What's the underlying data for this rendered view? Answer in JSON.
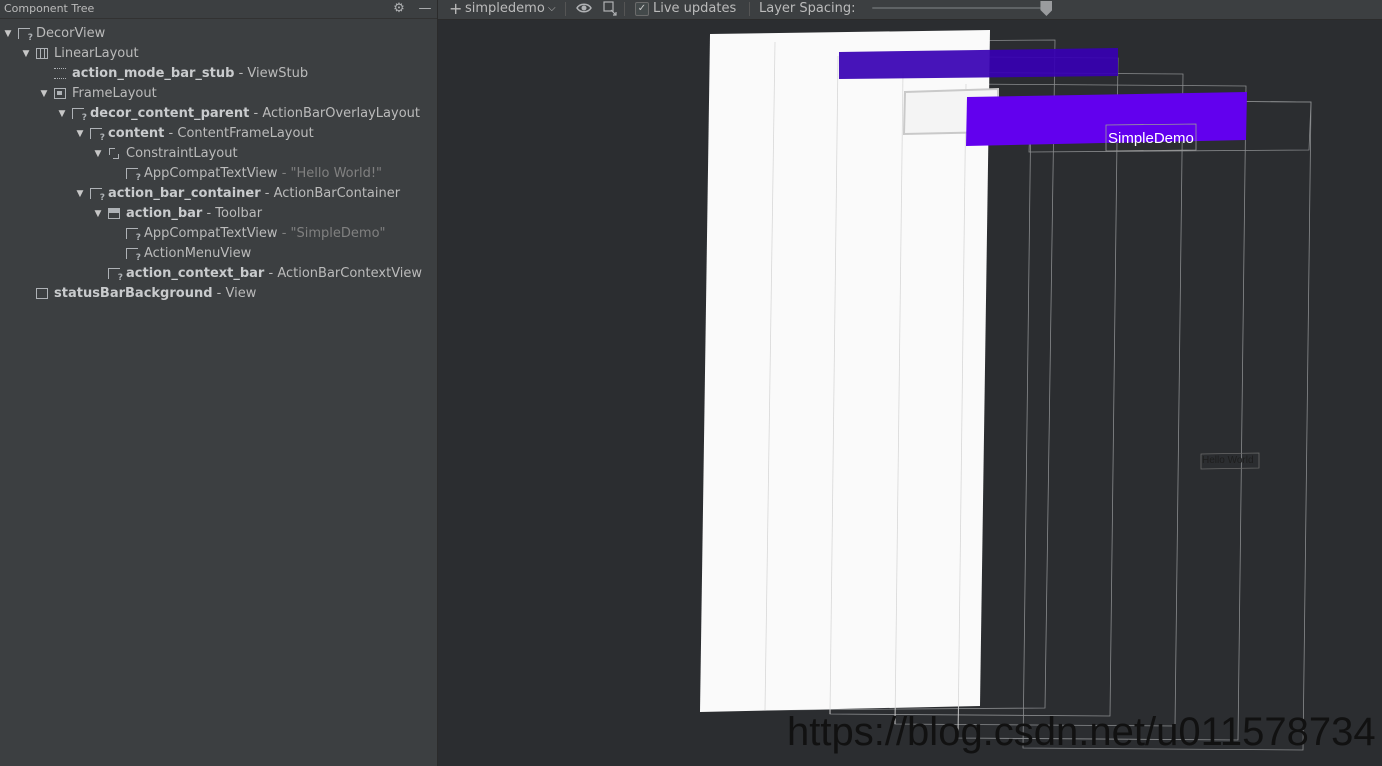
{
  "panel": {
    "title": "Component Tree",
    "settings_icon": "gear-icon",
    "minimize_icon": "minus-icon"
  },
  "tree": [
    {
      "id": "decorview",
      "depth": 0,
      "expandable": true,
      "icon": "text-view-icon",
      "name": "DecorView",
      "bold": false,
      "type": "",
      "text": ""
    },
    {
      "id": "linearlayout",
      "depth": 1,
      "expandable": true,
      "icon": "linear-layout-icon",
      "name": "LinearLayout",
      "bold": false,
      "type": "",
      "text": ""
    },
    {
      "id": "action_mode_bar_stub",
      "depth": 2,
      "expandable": false,
      "icon": "view-stub-icon",
      "name": "action_mode_bar_stub",
      "bold": true,
      "type": "ViewStub",
      "text": ""
    },
    {
      "id": "framelayout",
      "depth": 2,
      "expandable": true,
      "icon": "frame-layout-icon",
      "name": "FrameLayout",
      "bold": false,
      "type": "",
      "text": ""
    },
    {
      "id": "decor_content_parent",
      "depth": 3,
      "expandable": true,
      "icon": "text-view-icon",
      "name": "decor_content_parent",
      "bold": true,
      "type": "ActionBarOverlayLayout",
      "text": ""
    },
    {
      "id": "content",
      "depth": 4,
      "expandable": true,
      "icon": "text-view-icon",
      "name": "content",
      "bold": true,
      "type": "ContentFrameLayout",
      "text": ""
    },
    {
      "id": "constraintlayout",
      "depth": 5,
      "expandable": true,
      "icon": "constraint-layout-icon",
      "name": "ConstraintLayout",
      "bold": false,
      "type": "",
      "text": ""
    },
    {
      "id": "appcompattextview_hello",
      "depth": 6,
      "expandable": false,
      "icon": "text-view-icon",
      "name": "AppCompatTextView",
      "bold": false,
      "type": "",
      "text": "\"Hello World!\""
    },
    {
      "id": "action_bar_container",
      "depth": 4,
      "expandable": true,
      "icon": "text-view-icon",
      "name": "action_bar_container",
      "bold": true,
      "type": "ActionBarContainer",
      "text": ""
    },
    {
      "id": "action_bar",
      "depth": 5,
      "expandable": true,
      "icon": "toolbar-icon",
      "name": "action_bar",
      "bold": true,
      "type": "Toolbar",
      "text": ""
    },
    {
      "id": "appcompattextview_simpledemo",
      "depth": 6,
      "expandable": false,
      "icon": "text-view-icon",
      "name": "AppCompatTextView",
      "bold": false,
      "type": "",
      "text": "\"SimpleDemo\""
    },
    {
      "id": "actionmenuview",
      "depth": 6,
      "expandable": false,
      "icon": "text-view-icon",
      "name": "ActionMenuView",
      "bold": false,
      "type": "",
      "text": ""
    },
    {
      "id": "action_context_bar",
      "depth": 5,
      "expandable": false,
      "icon": "text-view-icon",
      "name": "action_context_bar",
      "bold": true,
      "type": "ActionBarContextView",
      "text": ""
    },
    {
      "id": "statusbarbackground",
      "depth": 1,
      "expandable": false,
      "icon": "view-icon",
      "name": "statusBarBackground",
      "bold": true,
      "type": "View",
      "text": ""
    }
  ],
  "toolbar": {
    "process_label": "simpledemo",
    "add_icon": "plus-icon",
    "dropdown_icon": "chevron-down-icon",
    "eye_icon": "eye-icon",
    "export_icon": "export-icon",
    "live_updates_checked": true,
    "live_updates_label": "Live updates",
    "layer_spacing_label": "Layer Spacing:",
    "layer_spacing_value": 0.98
  },
  "viewport": {
    "toolbar_title": "SimpleDemo",
    "hello_text": "Hello World",
    "colors": {
      "primary_dark": "#3700b3",
      "primary": "#6200ee",
      "window_bg": "#fafafa",
      "outline": "#8a8c8e"
    }
  },
  "watermark": "https://blog.csdn.net/u011578734"
}
